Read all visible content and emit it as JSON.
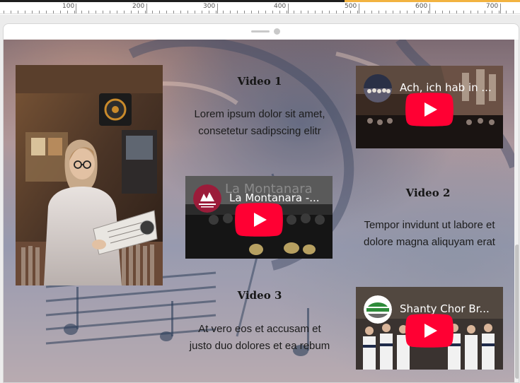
{
  "ruler": {
    "labels": [
      "100",
      "200",
      "300",
      "400",
      "500",
      "600",
      "700"
    ]
  },
  "colors": {
    "accent_bar": "#f2b341",
    "youtube_red": "#ff0000"
  },
  "content": {
    "photo": {
      "icon": "person-reading-record-photo"
    },
    "items": [
      {
        "title": "Video 1",
        "text": "Lorem ipsum dolor sit amet, consetetur sadipscing elitr"
      },
      {
        "title": "Video 2",
        "text": "Tempor invidunt ut labore et dolore magna aliquyam erat"
      },
      {
        "title": "Video 3",
        "text": "At vero eos et accusam et justo duo dolores et ea rebum"
      }
    ],
    "videos": [
      {
        "title": "Ach, ich hab in ...",
        "channel_icon": "choir-channel-avatar"
      },
      {
        "title": "La Montanara -...",
        "channel_icon": "mountain-channel-avatar",
        "overlay_text": "La Montanara"
      },
      {
        "title": "Shanty Chor Br...",
        "channel_icon": "shanty-channel-avatar"
      }
    ]
  }
}
